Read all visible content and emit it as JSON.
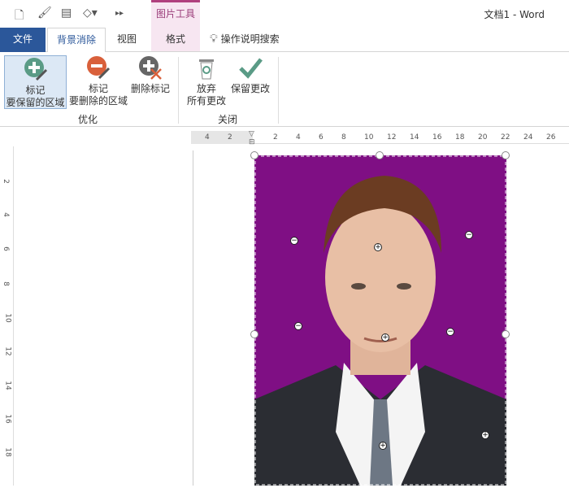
{
  "quick_access": {
    "icons": [
      "new-document-icon",
      "format-painter-icon",
      "text-box-icon",
      "shapes-icon",
      "more-icon"
    ]
  },
  "context_tab": {
    "label": "图片工具",
    "color": "#9b3d7a"
  },
  "window_title": "文档1  -  Word",
  "tabs": [
    {
      "label": "文件"
    },
    {
      "label": "背景消除",
      "active": true
    },
    {
      "label": "视图"
    },
    {
      "label": "格式"
    }
  ],
  "search_label": "操作说明搜索",
  "ribbon": {
    "groups": [
      {
        "label": "优化",
        "buttons": [
          {
            "line1": "标记",
            "line2": "要保留的区域"
          },
          {
            "line1": "标记",
            "line2": "要删除的区域"
          },
          {
            "line1": "删除标记",
            "line2": ""
          }
        ]
      },
      {
        "label": "关闭",
        "buttons": [
          {
            "line1": "放弃",
            "line2": "所有更改"
          },
          {
            "line1": "保留更改",
            "line2": ""
          }
        ]
      }
    ]
  },
  "hruler_ticks": [
    "4",
    "2",
    "2",
    "4",
    "6",
    "8",
    "10",
    "12",
    "14",
    "16",
    "18",
    "20",
    "22",
    "24",
    "26"
  ],
  "vruler_ticks": [
    "2",
    "4",
    "6",
    "8",
    "10",
    "12",
    "14",
    "16",
    "18"
  ],
  "colors": {
    "accent": "#2b579a",
    "photo_bg": "#7f0f84",
    "keep": "#5a9b86",
    "remove": "#d9603b"
  }
}
